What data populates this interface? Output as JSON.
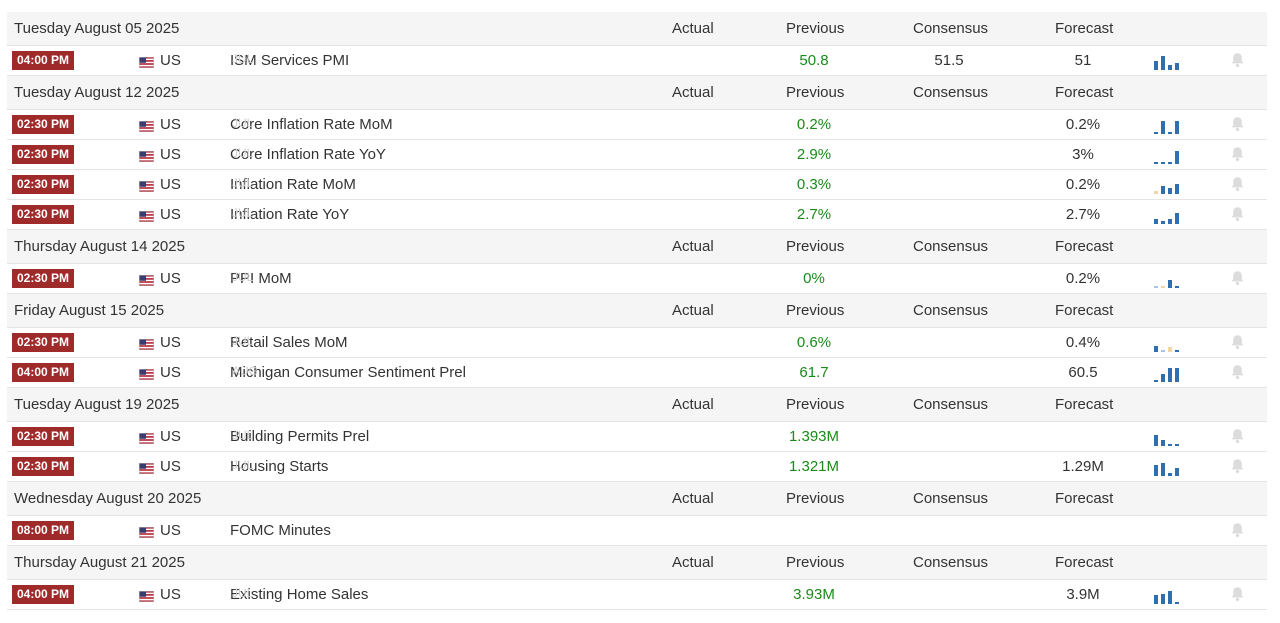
{
  "columns": {
    "actual": "Actual",
    "previous": "Previous",
    "consensus": "Consensus",
    "forecast": "Forecast"
  },
  "colors": {
    "time_badge": "#9f2a2a",
    "previous_value": "#1a8a1a",
    "spark_blue": "#2e6fb0",
    "spark_neutral": "#a9c6e6",
    "spark_tan": "#f0d6a6"
  },
  "groups": [
    {
      "date": "Tuesday August 05 2025",
      "events": [
        {
          "time": "04:00 PM",
          "country": "US",
          "event": "ISM Services PMI",
          "ref": "JUL",
          "actual": "",
          "previous": "50.8",
          "consensus": "51.5",
          "forecast": "51",
          "spark": [
            0.55,
            0.85,
            0.3,
            0.45
          ],
          "spark_colors": [
            "b",
            "b",
            "b",
            "b"
          ]
        }
      ]
    },
    {
      "date": "Tuesday August 12 2025",
      "events": [
        {
          "time": "02:30 PM",
          "country": "US",
          "event": "Core Inflation Rate MoM",
          "ref": "JUL",
          "actual": "",
          "previous": "0.2%",
          "consensus": "",
          "forecast": "0.2%",
          "spark": [
            0.1,
            0.8,
            0.1,
            0.8
          ],
          "spark_colors": [
            "b",
            "b",
            "b",
            "b"
          ]
        },
        {
          "time": "02:30 PM",
          "country": "US",
          "event": "Core Inflation Rate YoY",
          "ref": "JUL",
          "actual": "",
          "previous": "2.9%",
          "consensus": "",
          "forecast": "3%",
          "spark": [
            0.1,
            0.1,
            0.1,
            0.8
          ],
          "spark_colors": [
            "b",
            "b",
            "b",
            "b"
          ]
        },
        {
          "time": "02:30 PM",
          "country": "US",
          "event": "Inflation Rate MoM",
          "ref": "JUL",
          "actual": "",
          "previous": "0.3%",
          "consensus": "",
          "forecast": "0.2%",
          "spark": [
            0.2,
            0.5,
            0.4,
            0.6
          ],
          "spark_colors": [
            "t",
            "b",
            "b",
            "b"
          ]
        },
        {
          "time": "02:30 PM",
          "country": "US",
          "event": "Inflation Rate YoY",
          "ref": "JUL",
          "actual": "",
          "previous": "2.7%",
          "consensus": "",
          "forecast": "2.7%",
          "spark": [
            0.3,
            0.2,
            0.3,
            0.7
          ],
          "spark_colors": [
            "b",
            "b",
            "b",
            "b"
          ]
        }
      ]
    },
    {
      "date": "Thursday August 14 2025",
      "events": [
        {
          "time": "02:30 PM",
          "country": "US",
          "event": "PPI MoM",
          "ref": "JUL",
          "actual": "",
          "previous": "0%",
          "consensus": "",
          "forecast": "0.2%",
          "spark": [
            0.1,
            0.1,
            0.5,
            0.0
          ],
          "spark_colors": [
            "n",
            "t",
            "b",
            "b"
          ]
        }
      ]
    },
    {
      "date": "Friday August 15 2025",
      "events": [
        {
          "time": "02:30 PM",
          "country": "US",
          "event": "Retail Sales MoM",
          "ref": "JUL",
          "actual": "",
          "previous": "0.6%",
          "consensus": "",
          "forecast": "0.4%",
          "spark": [
            0.4,
            0.1,
            0.3,
            0.1
          ],
          "spark_colors": [
            "b",
            "n",
            "t",
            "b"
          ]
        },
        {
          "time": "04:00 PM",
          "country": "US",
          "event": "Michigan Consumer Sentiment Prel",
          "ref": "AUG",
          "actual": "",
          "previous": "61.7",
          "consensus": "",
          "forecast": "60.5",
          "spark": [
            0.1,
            0.5,
            0.85,
            0.85
          ],
          "spark_colors": [
            "b",
            "b",
            "b",
            "b"
          ]
        }
      ]
    },
    {
      "date": "Tuesday August 19 2025",
      "events": [
        {
          "time": "02:30 PM",
          "country": "US",
          "event": "Building Permits Prel",
          "ref": "JUL",
          "actual": "",
          "previous": "1.393M",
          "consensus": "",
          "forecast": "",
          "spark": [
            0.7,
            0.4,
            0.1,
            0.1
          ],
          "spark_colors": [
            "b",
            "b",
            "b",
            "b"
          ]
        },
        {
          "time": "02:30 PM",
          "country": "US",
          "event": "Housing Starts",
          "ref": "JUL",
          "actual": "",
          "previous": "1.321M",
          "consensus": "",
          "forecast": "1.29M",
          "spark": [
            0.7,
            0.8,
            0.2,
            0.5
          ],
          "spark_colors": [
            "b",
            "b",
            "b",
            "b"
          ]
        }
      ]
    },
    {
      "date": "Wednesday August 20 2025",
      "events": [
        {
          "time": "08:00 PM",
          "country": "US",
          "event": "FOMC Minutes",
          "ref": "",
          "actual": "",
          "previous": "",
          "consensus": "",
          "forecast": "",
          "spark": [],
          "spark_colors": []
        }
      ]
    },
    {
      "date": "Thursday August 21 2025",
      "events": [
        {
          "time": "04:00 PM",
          "country": "US",
          "event": "Existing Home Sales",
          "ref": "JUL",
          "actual": "",
          "previous": "3.93M",
          "consensus": "",
          "forecast": "3.9M",
          "spark": [
            0.55,
            0.6,
            0.8,
            0.1
          ],
          "spark_colors": [
            "b",
            "b",
            "b",
            "b"
          ]
        }
      ]
    }
  ]
}
